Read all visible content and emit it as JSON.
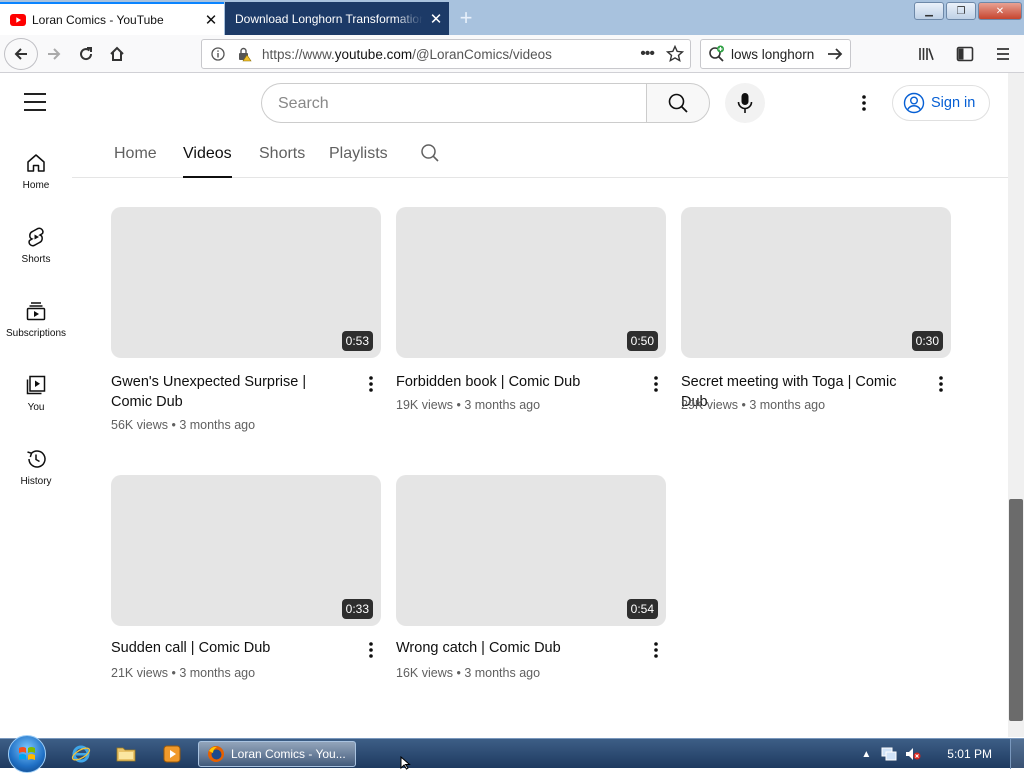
{
  "browser": {
    "tabs": [
      {
        "title": "Loran Comics - YouTube",
        "icon": "youtube-icon"
      },
      {
        "title": "Download Longhorn Transformation",
        "icon": "none"
      }
    ],
    "url_prefix": "https://www.",
    "url_domain": "youtube.com",
    "url_path": "/@LoranComics/videos",
    "search_query": "lows longhorn"
  },
  "youtube": {
    "search_placeholder": "Search",
    "sign_in": "Sign in",
    "sidebar": [
      "Home",
      "Shorts",
      "Subscriptions",
      "You",
      "History"
    ],
    "channel_tabs": [
      "Home",
      "Videos",
      "Shorts",
      "Playlists"
    ],
    "active_tab": "Videos",
    "videos": [
      {
        "title": "Gwen's Unexpected Surprise | Comic Dub",
        "duration": "0:53",
        "views": "56K views",
        "age": "3 months ago"
      },
      {
        "title": "Forbidden book | Comic Dub",
        "duration": "0:50",
        "views": "19K views",
        "age": "3 months ago"
      },
      {
        "title": "Secret meeting with Toga | Comic Dub",
        "duration": "0:30",
        "views": "29K views",
        "age": "3 months ago"
      },
      {
        "title": "Sudden call | Comic Dub",
        "duration": "0:33",
        "views": "21K views",
        "age": "3 months ago"
      },
      {
        "title": "Wrong catch | Comic Dub",
        "duration": "0:54",
        "views": "16K views",
        "age": "3 months ago"
      }
    ]
  },
  "taskbar": {
    "active_app": "Loran Comics - You...",
    "clock": "5:01 PM"
  },
  "colors": {
    "youtube_red": "#ff0000",
    "link_blue": "#065fd4",
    "tab_active_accent": "#0a84ff",
    "thumbnail_placeholder": "#e5e5e5"
  }
}
